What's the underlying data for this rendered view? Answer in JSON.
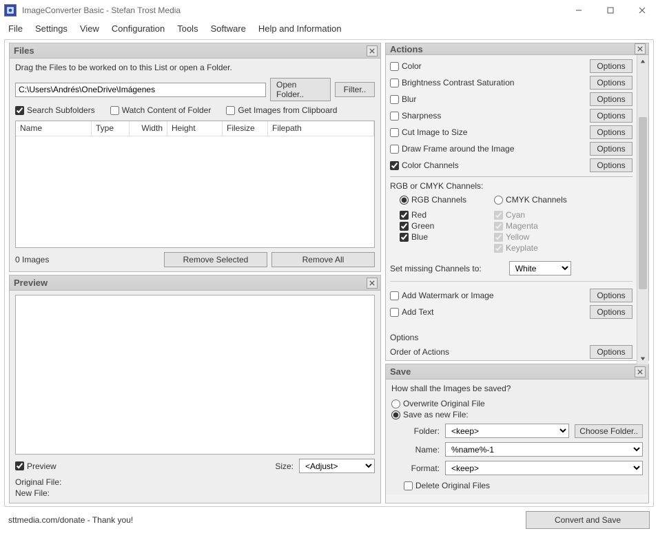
{
  "window": {
    "title": "ImageConverter Basic - Stefan Trost Media"
  },
  "menu": {
    "file": "File",
    "settings": "Settings",
    "view": "View",
    "configuration": "Configuration",
    "tools": "Tools",
    "software": "Software",
    "help": "Help and Information"
  },
  "files": {
    "title": "Files",
    "instruction": "Drag the Files to be worked on to this List or open a Folder.",
    "path": "C:\\Users\\Andrés\\OneDrive\\Imágenes",
    "open_folder": "Open Folder..",
    "filter": "Filter..",
    "search_subfolders": "Search Subfolders",
    "watch_folder": "Watch Content of Folder",
    "get_clipboard": "Get Images from Clipboard",
    "columns": {
      "name": "Name",
      "type": "Type",
      "width": "Width",
      "height": "Height",
      "filesize": "Filesize",
      "filepath": "Filepath"
    },
    "count": "0 Images",
    "remove_selected": "Remove Selected",
    "remove_all": "Remove All"
  },
  "preview": {
    "title": "Preview",
    "cb_preview": "Preview",
    "size_label": "Size:",
    "size_value": "<Adjust>",
    "original": "Original File:",
    "newfile": "New File:"
  },
  "actions": {
    "title": "Actions",
    "options_btn": "Options",
    "items": {
      "color": "Color",
      "bcs": "Brightness Contrast Saturation",
      "blur": "Blur",
      "sharpness": "Sharpness",
      "cut": "Cut Image to Size",
      "frame": "Draw Frame around the Image",
      "channels": "Color Channels"
    },
    "channels": {
      "header": "RGB or CMYK Channels:",
      "rgb": "RGB Channels",
      "cmyk": "CMYK Channels",
      "red": "Red",
      "green": "Green",
      "blue": "Blue",
      "cyan": "Cyan",
      "magenta": "Magenta",
      "yellow": "Yellow",
      "keyplate": "Keyplate",
      "missing_label": "Set missing Channels to:",
      "missing_value": "White"
    },
    "watermark": "Add Watermark or Image",
    "addtext": "Add Text",
    "options_header": "Options",
    "order": "Order of Actions"
  },
  "save": {
    "title": "Save",
    "question": "How shall the Images be saved?",
    "overwrite": "Overwrite Original File",
    "saveas": "Save as new File:",
    "folder_label": "Folder:",
    "folder_value": "<keep>",
    "choose_folder": "Choose Folder..",
    "name_label": "Name:",
    "name_value": "%name%-1",
    "format_label": "Format:",
    "format_value": "<keep>",
    "delete_original": "Delete Original Files"
  },
  "footer": {
    "donate": "sttmedia.com/donate - Thank you!",
    "convert": "Convert and Save"
  }
}
